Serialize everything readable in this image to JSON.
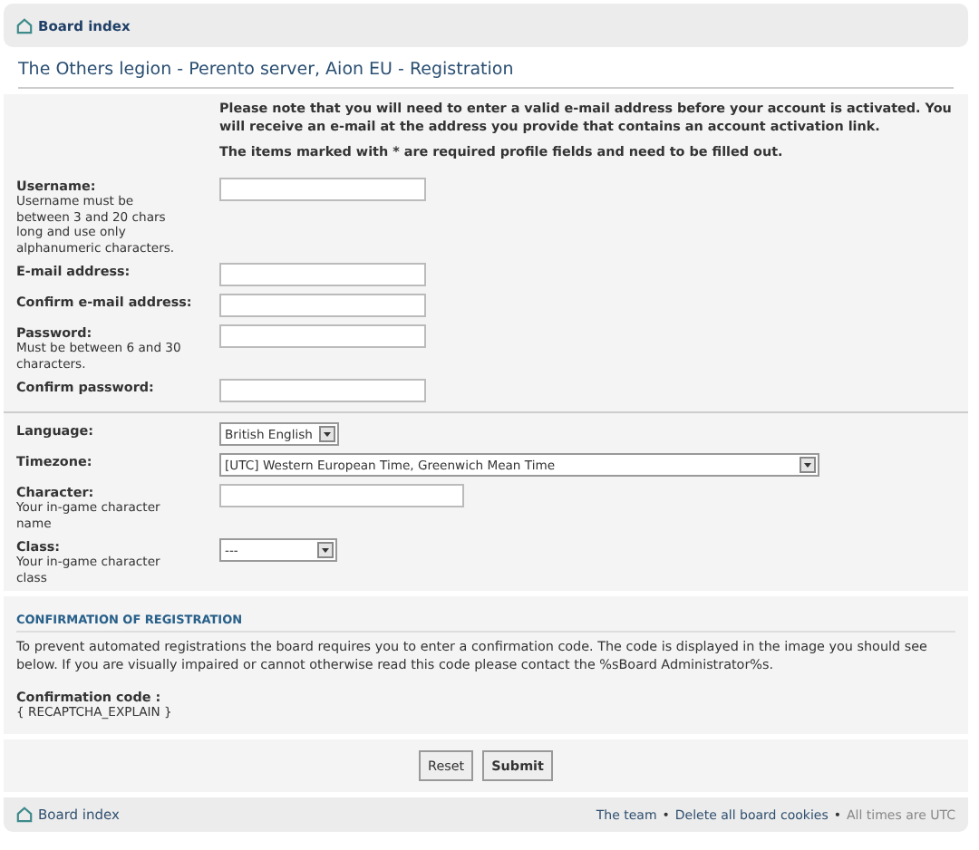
{
  "breadcrumb": {
    "label": "Board index"
  },
  "title": "The Others legion - Perento server, Aion EU - Registration",
  "notice": "Please note that you will need to enter a valid e-mail address before your account is activated. You will receive an e-mail at the address you provide that contains an account activation link.",
  "required_note": "The items marked with * are required profile fields and need to be filled out.",
  "account_fields": [
    {
      "label": "Username:",
      "explain": "Username must be between 3 and 20 chars long and use only alphanumeric characters.",
      "kind": "text"
    },
    {
      "label": "E-mail address:",
      "kind": "text"
    },
    {
      "label": "Confirm e-mail address:",
      "kind": "text"
    },
    {
      "label": "Password:",
      "explain": "Must be between 6 and 30 characters.",
      "kind": "text"
    },
    {
      "label": "Confirm password:",
      "kind": "text"
    }
  ],
  "profile_fields": [
    {
      "label": "Language:",
      "kind": "select",
      "value": "British English"
    },
    {
      "label": "Timezone:",
      "kind": "select",
      "value": "[UTC] Western European Time, Greenwich Mean Time"
    },
    {
      "label": "Character:",
      "explain": "Your in-game character name",
      "kind": "text"
    },
    {
      "label": "Class:",
      "explain": "Your in-game character class",
      "kind": "select",
      "value": "---"
    }
  ],
  "confirmation": {
    "heading": "CONFIRMATION OF REGISTRATION",
    "text": "To prevent automated registrations the board requires you to enter a confirmation code. The code is displayed in the image you should see below. If you are visually impaired or cannot otherwise read this code please contact the %sBoard Administrator%s.",
    "code_label": "Confirmation code :",
    "code_value": "{ RECAPTCHA_EXPLAIN }"
  },
  "buttons": [
    {
      "label": "Reset",
      "kind": "reset"
    },
    {
      "label": "Submit",
      "kind": "submit"
    }
  ],
  "footer": {
    "home": "Board index",
    "links": [
      "The team",
      "Delete all board cookies"
    ],
    "separator": "•",
    "note": "All times are UTC"
  }
}
